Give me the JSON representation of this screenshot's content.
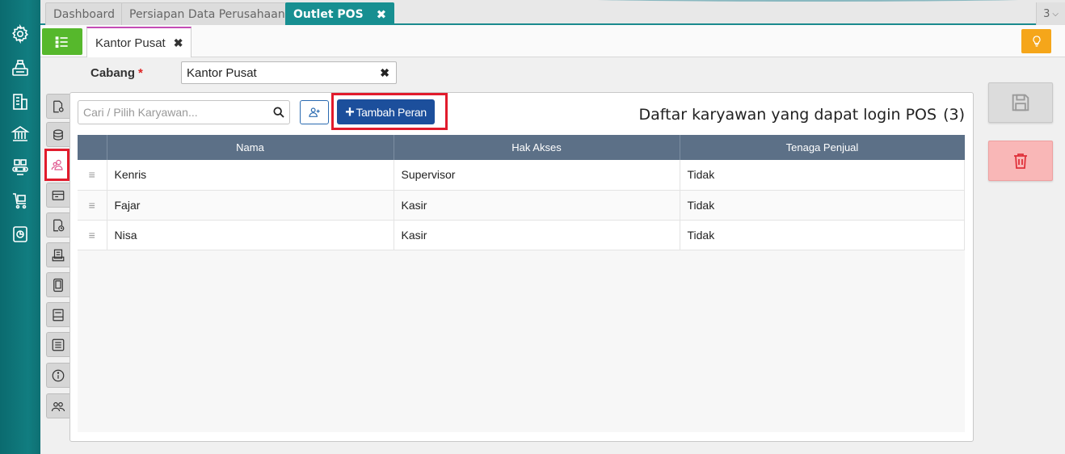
{
  "top_tabs": [
    {
      "label": "Dashboard"
    },
    {
      "label": "Persiapan Data Perusahaan"
    },
    {
      "label": "Outlet POS"
    }
  ],
  "tab_count": "3",
  "sub_tab": {
    "label": "Kantor Pusat"
  },
  "cabang": {
    "label": "Cabang",
    "required_mark": "*",
    "value": "Kantor Pusat"
  },
  "search": {
    "placeholder": "Cari / Pilih Karyawan..."
  },
  "tambah_peran": {
    "label": "Tambah Peran"
  },
  "list": {
    "title": "Daftar karyawan yang dapat login POS",
    "count": "(3)"
  },
  "table": {
    "headers": [
      "Nama",
      "Hak Akses",
      "Tenaga Penjual"
    ],
    "rows": [
      {
        "nama": "Kenris",
        "hak_akses": "Supervisor",
        "tenaga_penjual": "Tidak"
      },
      {
        "nama": "Fajar",
        "hak_akses": "Kasir",
        "tenaga_penjual": "Tidak"
      },
      {
        "nama": "Nisa",
        "hak_akses": "Kasir",
        "tenaga_penjual": "Tidak"
      }
    ]
  },
  "icons": {
    "sidebar": [
      "gear-icon",
      "cash-register-icon",
      "building-icon",
      "bank-icon",
      "conveyor-icon",
      "cart-icon",
      "report-icon"
    ],
    "side_tabs": [
      "document-gear-icon",
      "stack-icon",
      "users-icon",
      "card-icon",
      "document-time-icon",
      "printer-icon",
      "tablet-icon",
      "display-icon",
      "list-icon",
      "info-icon",
      "group-icon"
    ]
  },
  "colors": {
    "accent": "#178f91",
    "primary_button": "#1c4f9c",
    "header_row": "#5c7087",
    "highlight": "#e11b2c",
    "menu_button": "#56b82c",
    "bulb_button": "#f5a61a",
    "delete_button": "#f9b7b7"
  }
}
